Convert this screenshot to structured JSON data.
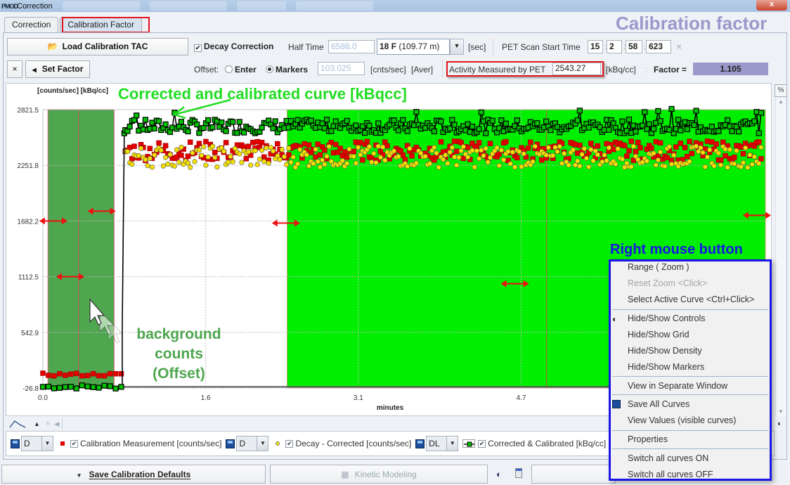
{
  "window": {
    "title": "Correction",
    "close_label": "x"
  },
  "tabs": [
    {
      "label": "Correction",
      "active": false
    },
    {
      "label": "Calibration Factor",
      "active": true
    }
  ],
  "annotations": {
    "calibration_factor": "Calibration factor",
    "corrected_curve": "Corrected and calibrated curve [kBqcc]",
    "background_line1": "background",
    "background_line2": "counts",
    "background_line3": "(Offset)",
    "right_mouse": "Right mouse button"
  },
  "toolbar": {
    "load_button": "Load Calibration TAC",
    "decay_correction_label": "Decay Correction",
    "decay_correction_checked": true,
    "half_time_label": "Half Time",
    "half_time_value": "6588.0",
    "isotope_value": "18 F (109.77 m)",
    "isotope_bold": "18 F",
    "isotope_rest": " (109.77 m)",
    "sec_unit": "[sec]",
    "scan_start_label": "PET Scan Start Time",
    "scan_start_h": "15",
    "scan_start_m": "2",
    "scan_start_s": "58",
    "scan_start_ms": "623",
    "clear_label": "×",
    "close_x": "×",
    "set_factor_button": "Set Factor",
    "offset_label": "Offset:",
    "offset_enter": "Enter",
    "offset_markers": "Markers",
    "offset_selected": "Markers",
    "offset_value": "103.025",
    "offset_unit": "[cnts/sec]",
    "offset_aver": "[Aver]",
    "activity_label": "Activity Measured by PET",
    "activity_value": "2543.27",
    "activity_unit": "[kBq/cc]",
    "factor_label": "Factor =",
    "factor_value": "1.105"
  },
  "chart_data": {
    "type": "scatter",
    "ylabel": "[counts/sec] [kBq/cc]",
    "xlabel": "minutes",
    "x_ticks": [
      "0.0",
      "1.6",
      "3.1",
      "4.7"
    ],
    "y_ticks": [
      "2821.5",
      "2251.8",
      "1682.2",
      "1112.5",
      "542.9",
      "-26.8"
    ],
    "xlim": [
      0.0,
      7.1
    ],
    "ylim": [
      -26.8,
      2821.5
    ],
    "grid": true,
    "background_region_minutes": [
      0.05,
      0.7
    ],
    "background_marker_minutes": 0.35,
    "calibration_region_minutes": [
      2.4,
      7.1
    ],
    "calibration_marker_minutes": 4.95,
    "injection_time_minutes": 0.78,
    "series": [
      {
        "name": "Calibration Measurement [counts/sec]",
        "marker": "red-square",
        "color": "#e00000",
        "baseline": 110,
        "plateau": 2400
      },
      {
        "name": "Decay - Corrected [counts/sec]",
        "marker": "yellow-circle",
        "color": "#f5e000",
        "baseline": 10,
        "plateau": 2390
      },
      {
        "name": "Corrected & Calibrated [kBq/cc]",
        "marker": "green-square-line",
        "color": "#00c000",
        "baseline": -15,
        "plateau": 2650
      }
    ]
  },
  "plot_controls": {
    "up_label": "▲",
    "x_label": "×",
    "left_label": "◀",
    "percent_label": "%"
  },
  "legend": [
    {
      "save": true,
      "mode": "D",
      "label": "Calibration Measurement [counts/sec]",
      "checked": true
    },
    {
      "save": true,
      "mode": "D",
      "label": "Decay - Corrected [counts/sec]",
      "checked": true
    },
    {
      "save": true,
      "mode": "DL",
      "label": "Corrected & Calibrated [kBq/cc]",
      "checked": true
    }
  ],
  "bottom": {
    "save_defaults": "Save Calibration Defaults",
    "kinetic_modeling": "Kinetic Modeling"
  },
  "context_menu": {
    "items": [
      {
        "label": "Range ( Zoom )",
        "disabled": false
      },
      {
        "label": "Reset Zoom <Click>",
        "disabled": true
      },
      {
        "label": "Select Active Curve <Ctrl+Click>",
        "disabled": false
      },
      {
        "label": "Hide/Show Controls",
        "disabled": false,
        "icon": "contrast-icon"
      },
      {
        "label": "Hide/Show Grid",
        "disabled": false
      },
      {
        "label": "Hide/Show Density",
        "disabled": false
      },
      {
        "label": "Hide/Show Markers",
        "disabled": false
      },
      {
        "label": "View in Separate Window",
        "disabled": false
      },
      {
        "label": "Save All Curves",
        "disabled": false,
        "icon": "save-icon"
      },
      {
        "label": "View Values (visible curves)",
        "disabled": false
      },
      {
        "label": "Properties",
        "disabled": false
      },
      {
        "label": "Switch all curves ON",
        "disabled": false
      },
      {
        "label": "Switch all curves OFF",
        "disabled": false
      }
    ]
  },
  "colors": {
    "background_region": "#4ea64e",
    "calibration_region": "#00ee00",
    "annotation_green": "#22dd22",
    "annotation_dark_green": "#4ea64e",
    "menu_border": "#1a16e8",
    "highlight_red": "#e0151c",
    "factor_bg": "#9b98cc"
  }
}
